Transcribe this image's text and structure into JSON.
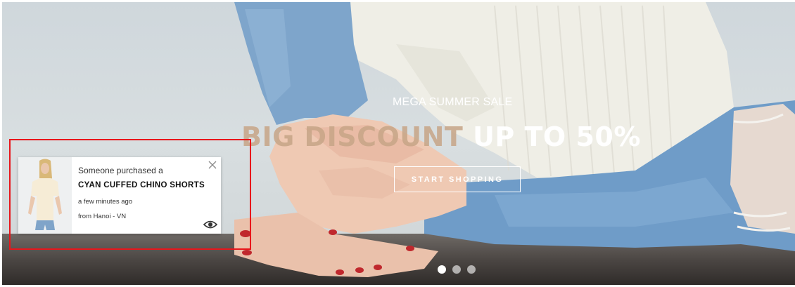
{
  "hero": {
    "subtitle": "MEGA SUMMER SALE",
    "headline_accent": "BIG DISCOUNT",
    "headline_main": "UP TO 50%",
    "cta_label": "START SHOPPING",
    "dots": [
      "slide-1",
      "slide-2",
      "slide-3"
    ],
    "active_dot": 0,
    "accent_color": "#c7a587"
  },
  "notification": {
    "line1": "Someone purchased a",
    "product": "CYAN CUFFED CHINO SHORTS",
    "time": "a few minutes ago",
    "location": "from Hanoi - VN",
    "close_icon": "close-icon",
    "view_icon": "eye-icon"
  },
  "annotation": {
    "highlight_color": "#e8161b"
  }
}
